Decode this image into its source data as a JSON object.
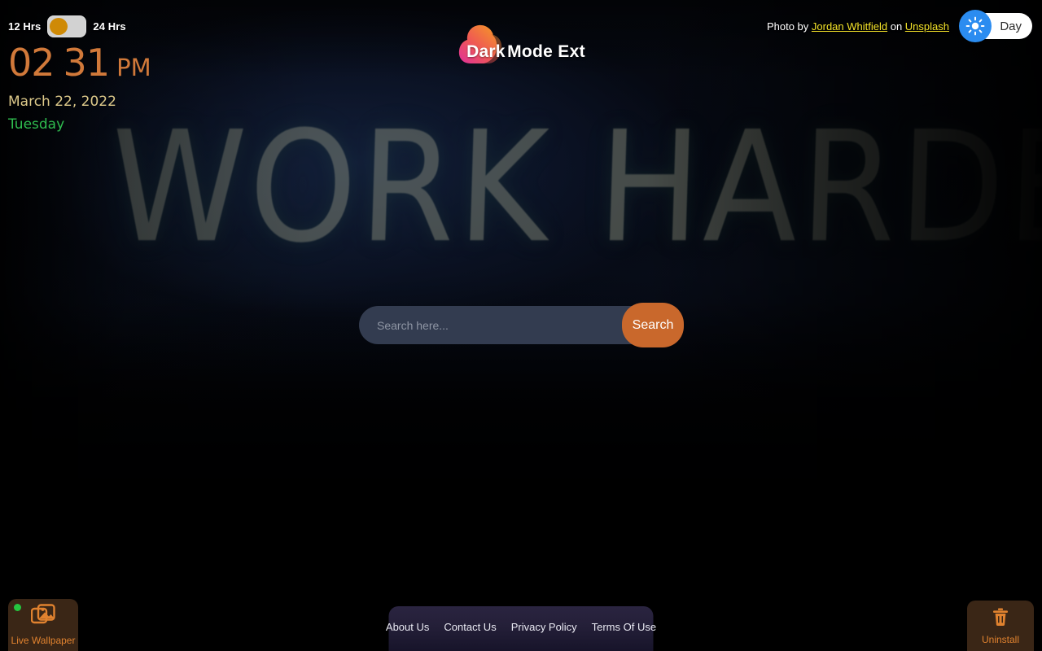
{
  "brand": {
    "mark_icon": "dark-mode-cloud-logo",
    "word_primary": "Dark",
    "word_secondary": "Mode Ext",
    "gradient_from": "#e0309a",
    "gradient_to": "#f5a21f"
  },
  "clock": {
    "toggle": {
      "left_label": "12 Hrs",
      "right_label": "24 Hrs",
      "state": "12",
      "knob_color": "#cf8a06",
      "track_color": "#d2d2d2"
    },
    "hour": "02",
    "minute": "31",
    "meridiem": "PM",
    "time_color": "#d1793a",
    "date": "March 22, 2022",
    "date_color": "#ddc98a",
    "weekday": "Tuesday",
    "weekday_color": "#2fbd4f"
  },
  "photo_credit": {
    "prefix": "Photo by ",
    "author": "Jordan Whitfield",
    "middle": " on ",
    "source": "Unsplash",
    "link_color": "#f5e429"
  },
  "theme_toggle": {
    "label": "Day",
    "icon": "sun-icon",
    "knob_color": "#2b8cf0",
    "pill_color": "#ffffff"
  },
  "search": {
    "placeholder": "Search here...",
    "value": "",
    "button_label": "Search",
    "button_color": "#c9682c",
    "field_color": "#333c50"
  },
  "footer": {
    "links": [
      {
        "label": "About Us"
      },
      {
        "label": "Contact Us"
      },
      {
        "label": "Privacy Policy"
      },
      {
        "label": "Terms Of Use"
      }
    ]
  },
  "live_wallpaper": {
    "label": "Live Wallpaper",
    "icon": "images-stack-icon",
    "status_indicator": "on",
    "indicator_color": "#25c53f",
    "accent_color": "#e0822f"
  },
  "uninstall": {
    "label": "Uninstall",
    "icon": "trash-icon",
    "accent_color": "#e0822f"
  },
  "wallpaper": {
    "neon_text": "WORK HARDER",
    "description": "dark neon graffiti sign"
  }
}
